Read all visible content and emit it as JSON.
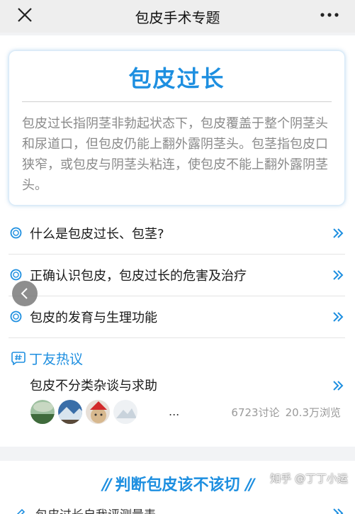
{
  "topbar": {
    "title": "包皮手术专题",
    "close_icon": "close-icon",
    "more_icon": "more-icon"
  },
  "intro_card": {
    "heading": "包皮过长",
    "description": "包皮过长指阴茎非勃起状态下，包皮覆盖于整个阴茎头和尿道口，但包皮仍能上翻外露阴茎头。包茎指包皮口狭窄，或包皮与阴茎头粘连，使包皮不能上翻外露阴茎头。"
  },
  "menu": [
    {
      "label": "什么是包皮过长、包茎?"
    },
    {
      "label": "正确认识包皮，包皮过长的危害及治疗"
    },
    {
      "label": "包皮的发育与生理功能"
    }
  ],
  "discussion": {
    "section_title": "丁友热议",
    "topic_title": "包皮不分类杂谈与求助",
    "more_avatars": "...",
    "discussion_count": "6723讨论",
    "view_count": "20.3万浏览"
  },
  "judge_section": {
    "title": "判断包皮该不该切",
    "slashes": "//",
    "first_item": "包皮过长自我评测量表"
  },
  "watermark": "知乎 @丁丁小运",
  "colors": {
    "accent": "#1e8fe0",
    "description_text": "#8a8a8a",
    "topbar_bg": "#eeeeee",
    "page_bg": "#f2f3f5"
  }
}
